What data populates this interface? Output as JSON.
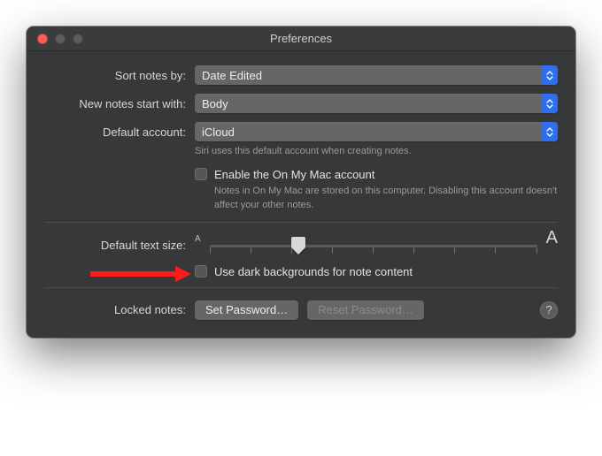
{
  "window": {
    "title": "Preferences"
  },
  "sort_notes": {
    "label": "Sort notes by:",
    "value": "Date Edited"
  },
  "new_notes": {
    "label": "New notes start with:",
    "value": "Body"
  },
  "default_account": {
    "label": "Default account:",
    "value": "iCloud",
    "hint": "Siri uses this default account when creating notes."
  },
  "on_my_mac": {
    "checkbox_label": "Enable the On My Mac account",
    "hint": "Notes in On My Mac are stored on this computer. Disabling this account doesn't affect your other notes."
  },
  "text_size": {
    "label": "Default text size:",
    "small_marker": "A",
    "large_marker": "A",
    "thumb_percent": 27
  },
  "dark_bg": {
    "checkbox_label": "Use dark backgrounds for note content"
  },
  "locked_notes": {
    "label": "Locked notes:",
    "set_password": "Set Password…",
    "reset_password": "Reset Password…"
  },
  "help_symbol": "?"
}
